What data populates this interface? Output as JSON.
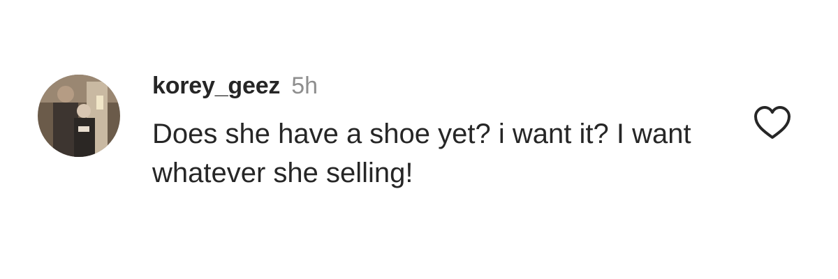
{
  "comment": {
    "username": "korey_geez",
    "time": "5h",
    "text": "Does she have a shoe yet? i want it? I want whatever she selling!",
    "avatar_icon": "profile-photo",
    "like_icon": "heart-outline-icon"
  },
  "colors": {
    "text": "#262626",
    "secondary_text": "#8e8e8e",
    "icon_stroke": "#262626",
    "background": "#ffffff"
  }
}
